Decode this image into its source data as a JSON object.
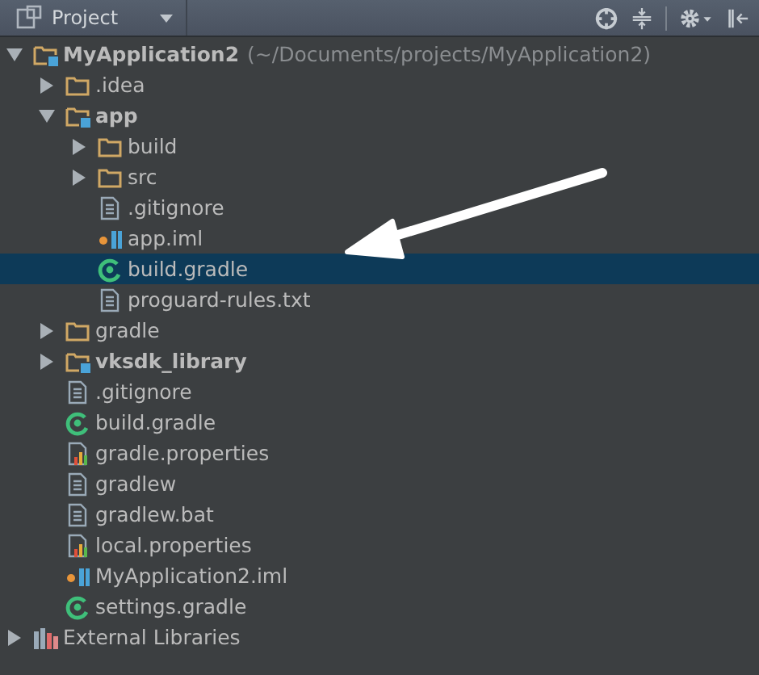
{
  "panel": {
    "title": "Project"
  },
  "tree": [
    {
      "kind": "module",
      "label": "MyApplication2",
      "path": "(~/Documents/projects/MyApplication2)",
      "expanded": true,
      "selected": false,
      "children": [
        {
          "kind": "folder",
          "label": ".idea",
          "expanded": false,
          "selected": false
        },
        {
          "kind": "module",
          "label": "app",
          "expanded": true,
          "selected": false,
          "children": [
            {
              "kind": "folder",
              "label": "build",
              "expanded": false,
              "selected": false
            },
            {
              "kind": "folder",
              "label": "src",
              "expanded": false,
              "selected": false
            },
            {
              "kind": "text",
              "label": ".gitignore",
              "selected": false
            },
            {
              "kind": "iml",
              "label": "app.iml",
              "selected": false
            },
            {
              "kind": "gradle",
              "label": "build.gradle",
              "selected": true
            },
            {
              "kind": "text",
              "label": "proguard-rules.txt",
              "selected": false
            }
          ]
        },
        {
          "kind": "folder",
          "label": "gradle",
          "expanded": false,
          "selected": false
        },
        {
          "kind": "module",
          "label": "vksdk_library",
          "expanded": false,
          "selected": false
        },
        {
          "kind": "text",
          "label": ".gitignore",
          "selected": false
        },
        {
          "kind": "gradle",
          "label": "build.gradle",
          "selected": false
        },
        {
          "kind": "properties",
          "label": "gradle.properties",
          "selected": false
        },
        {
          "kind": "text",
          "label": "gradlew",
          "selected": false
        },
        {
          "kind": "text",
          "label": "gradlew.bat",
          "selected": false
        },
        {
          "kind": "properties",
          "label": "local.properties",
          "selected": false
        },
        {
          "kind": "iml",
          "label": "MyApplication2.iml",
          "selected": false
        },
        {
          "kind": "gradle",
          "label": "settings.gradle",
          "selected": false
        }
      ]
    },
    {
      "kind": "libraries",
      "label": "External Libraries",
      "expanded": false,
      "selected": false
    }
  ]
}
